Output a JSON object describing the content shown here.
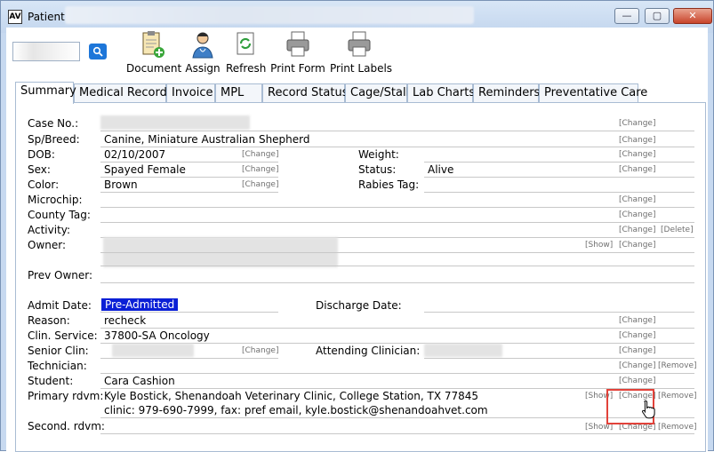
{
  "window": {
    "title": "Patient -",
    "app_icon": "AV",
    "minimize": "—",
    "maximize": "▢",
    "close": "✕"
  },
  "toolbar": {
    "search_icon": "magnifier-icon",
    "document": "Document",
    "assign": "Assign",
    "refresh": "Refresh",
    "print_form": "Print Form",
    "print_labels": "Print Labels"
  },
  "tabs": [
    "Summary",
    "Medical Record",
    "Invoice",
    "MPL",
    "Record Status",
    "Cage/Stall",
    "Lab Charts",
    "Reminders",
    "Preventative Care"
  ],
  "links": {
    "change": "[Change]",
    "show": "[Show]",
    "delete": "[Delete]",
    "remove": "[Remove]"
  },
  "fields": {
    "case_no": {
      "label": "Case No.:",
      "value": ""
    },
    "sp_breed": {
      "label": "Sp/Breed:",
      "value": "Canine, Miniature Australian Shepherd"
    },
    "dob": {
      "label": "DOB:",
      "value": "02/10/2007"
    },
    "weight": {
      "label": "Weight:",
      "value": ""
    },
    "sex": {
      "label": "Sex:",
      "value": "Spayed Female"
    },
    "status": {
      "label": "Status:",
      "value": "Alive"
    },
    "color": {
      "label": "Color:",
      "value": "Brown"
    },
    "rabies_tag": {
      "label": "Rabies Tag:",
      "value": ""
    },
    "microchip": {
      "label": "Microchip:",
      "value": ""
    },
    "county_tag": {
      "label": "County Tag:",
      "value": ""
    },
    "activity": {
      "label": "Activity:",
      "value": ""
    },
    "owner": {
      "label": "Owner:",
      "value": ""
    },
    "prev_owner": {
      "label": "Prev Owner:",
      "value": ""
    },
    "admit_date": {
      "label": "Admit Date:",
      "value": "Pre-Admitted"
    },
    "discharge_date": {
      "label": "Discharge Date:",
      "value": ""
    },
    "reason": {
      "label": "Reason:",
      "value": "recheck"
    },
    "clin_service": {
      "label": "Clin. Service:",
      "value": "37800-SA Oncology"
    },
    "senior_clin": {
      "label": "Senior Clin:",
      "value": ""
    },
    "attending_clinician": {
      "label": "Attending Clinician:",
      "value": ""
    },
    "technician": {
      "label": "Technician:",
      "value": ""
    },
    "student": {
      "label": "Student:",
      "value": "Cara Cashion"
    },
    "primary_rdvm": {
      "label": "Primary rdvm:",
      "value": "Kyle Bostick, Shenandoah Veterinary Clinic, College Station, TX 77845",
      "contact": "clinic: 979-690-7999, fax: pref email, kyle.bostick@shenandoahvet.com"
    },
    "second_rdvm": {
      "label": "Second. rdvm:",
      "value": ""
    }
  }
}
